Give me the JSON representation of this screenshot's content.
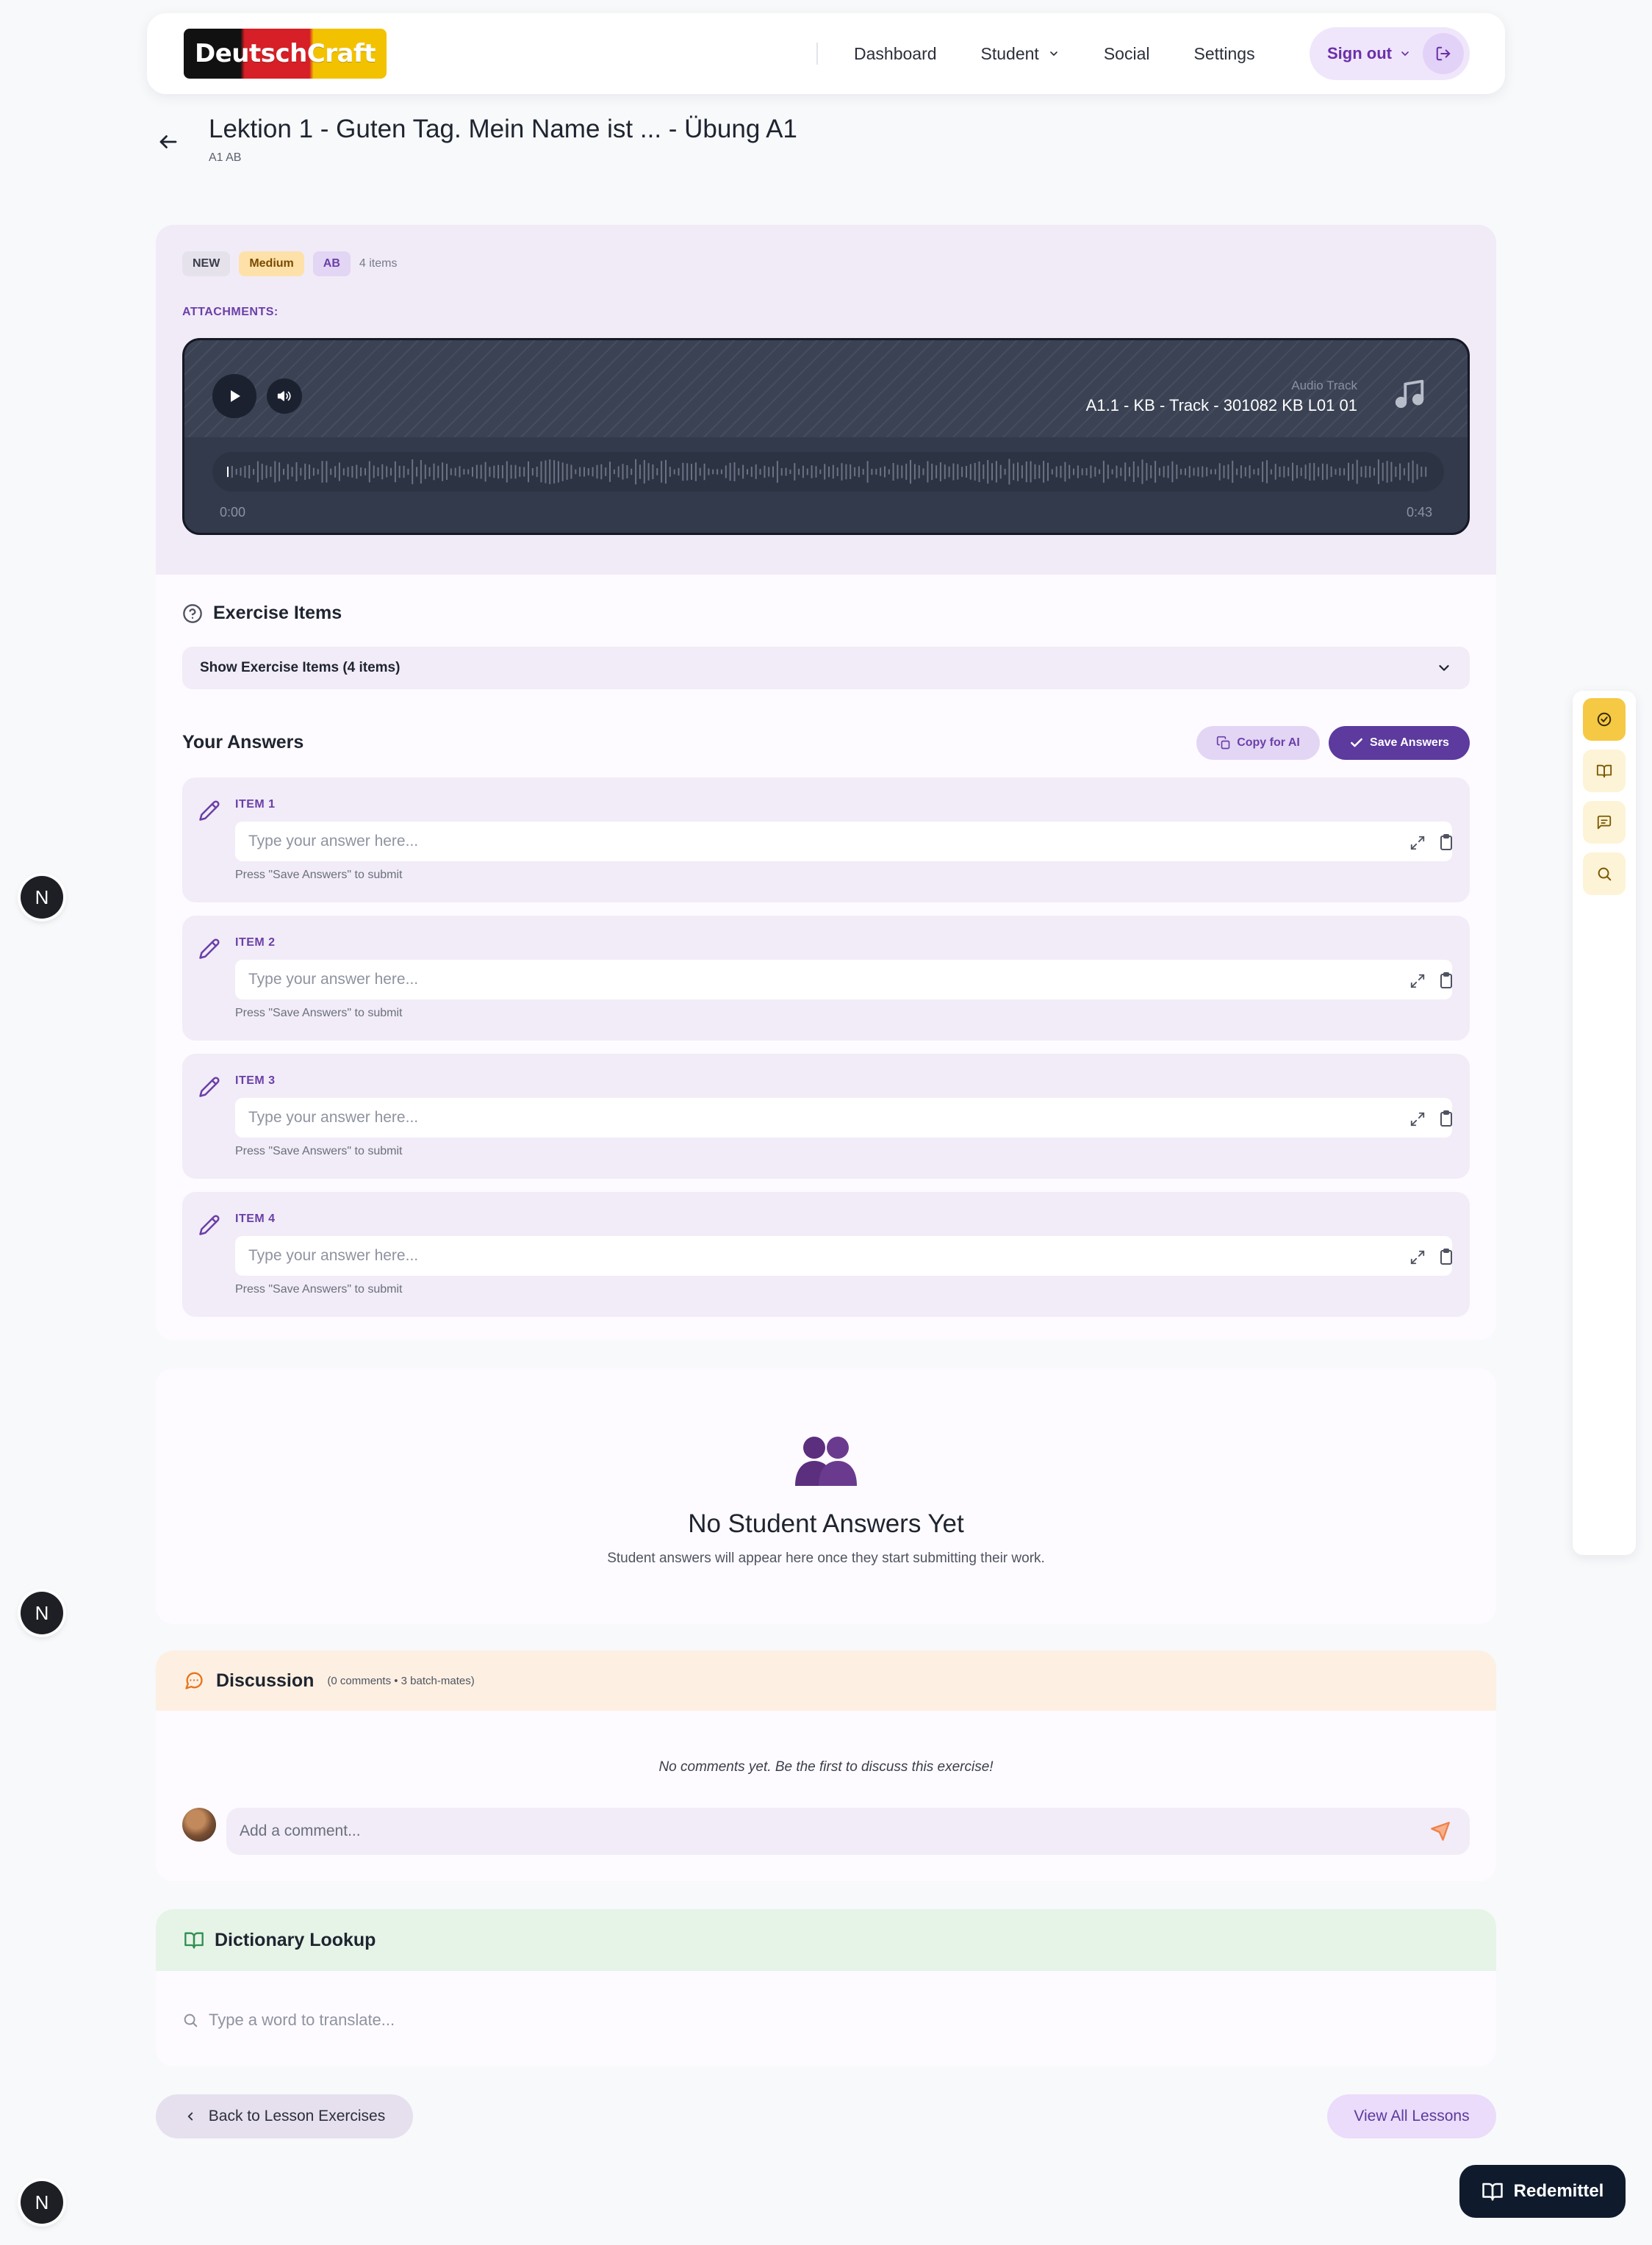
{
  "nav": {
    "logo_text": "DeutschCraft",
    "dashboard": "Dashboard",
    "student": "Student",
    "social": "Social",
    "settings": "Settings",
    "sign_out": "Sign out"
  },
  "header": {
    "title": "Lektion 1 - Guten Tag. Mein Name ist ... - Übung A1",
    "subtitle": "A1 AB"
  },
  "exercise": {
    "badges": {
      "new": "NEW",
      "level": "Medium",
      "type": "AB",
      "count": "4 items"
    },
    "attachments_label": "ATTACHMENTS:",
    "audio": {
      "kicker": "Audio Track",
      "title": "A1.1 - KB - Track - 301082 KB L01 01",
      "time_start": "0:00",
      "time_end": "0:43",
      "progress": 0
    },
    "items_title": "Exercise Items",
    "show_items_label": "Show Exercise Items (4 items)",
    "answers_title": "Your Answers",
    "copy_button": "Copy for AI",
    "save_button": "Save Answers",
    "answer_placeholder": "Type your answer here...",
    "answer_hint": "Press \"Save Answers\" to submit",
    "items": [
      {
        "label": "ITEM 1",
        "value": ""
      },
      {
        "label": "ITEM 2",
        "value": ""
      },
      {
        "label": "ITEM 3",
        "value": ""
      },
      {
        "label": "ITEM 4",
        "value": ""
      }
    ]
  },
  "students": {
    "title": "No Student Answers Yet",
    "subtitle": "Student answers will appear here once they start submitting their work."
  },
  "discussion": {
    "title": "Discussion",
    "meta": "(0 comments • 3 batch-mates)",
    "empty": "No comments yet. Be the first to discuss this exercise!",
    "placeholder": "Add a comment..."
  },
  "dictionary": {
    "title": "Dictionary Lookup",
    "placeholder": "Type a word to translate..."
  },
  "footer": {
    "back": "Back to Lesson Exercises",
    "all": "View All Lessons"
  },
  "rail": {
    "icons": [
      "check-circle-icon",
      "book-icon",
      "chat-icon",
      "search-icon"
    ],
    "redemittel": "Redemittel"
  },
  "floating_badge": "N",
  "colors": {
    "accent": "#5c3a9e",
    "accent_light": "#efe6fb",
    "card_purple": "#f1ebf8",
    "discussion_header": "#fdf0e2",
    "dictionary_header": "#e6f4e8",
    "rail_active": "#f6c944",
    "audio_bg": "#333a4b"
  }
}
